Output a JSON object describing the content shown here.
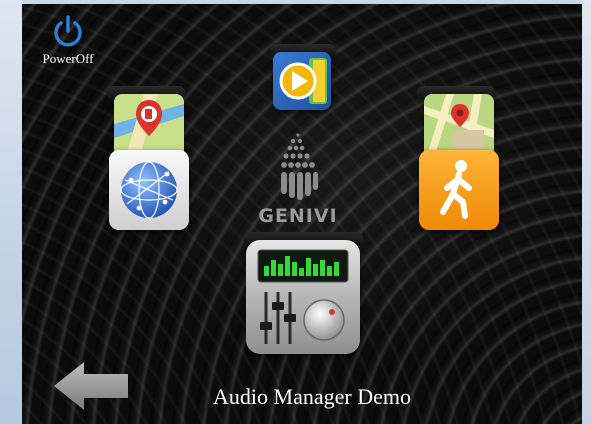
{
  "screen": {
    "title": "Audio Manager Demo",
    "brand": "GENIVI",
    "power": {
      "label": "PowerOff",
      "icon": "power-icon"
    },
    "back": {
      "icon": "back-arrow-icon"
    }
  },
  "apps": [
    {
      "id": "media-player",
      "icon": "media-play-icon"
    },
    {
      "id": "navigation-fuel",
      "icon": "map-fuel-pin-icon"
    },
    {
      "id": "internet",
      "icon": "globe-icon"
    },
    {
      "id": "navigation-map",
      "icon": "map-pin-icon"
    },
    {
      "id": "pedestrian",
      "icon": "walking-person-icon"
    },
    {
      "id": "audio-mixer",
      "icon": "equalizer-mixer-icon"
    }
  ],
  "colors": {
    "background": "#0a0a0a",
    "power": "#2f7fd6",
    "pedestrian": "#f59a12",
    "media": "#f2b705"
  }
}
